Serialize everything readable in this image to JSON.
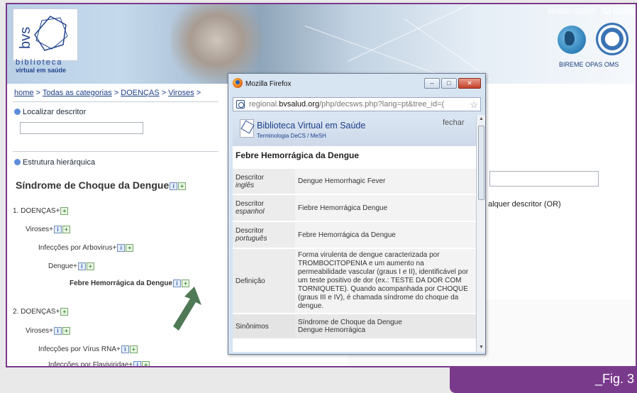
{
  "header": {
    "logo_text": "bvs",
    "logo_word": "biblioteca",
    "logo_sub": "virtual em saúde",
    "lang_es": "español",
    "lang_sep": "|",
    "lang_en": "english",
    "contact": "Contato",
    "orgs": "BIREME OPAS OMS"
  },
  "breadcrumb": {
    "home": "home",
    "cats": "Todas as categorias",
    "doencas": "DOENÇAS",
    "viroses": "Viroses",
    "sep": " > "
  },
  "search_section": {
    "title": "Localizar descritor"
  },
  "tree_section": {
    "title": "Estrutura hierárquica",
    "heading": "Síndrome de Choque da Dengue",
    "items": [
      {
        "label": "1. DOENÇAS+"
      },
      {
        "label": "Viroses+"
      },
      {
        "label": "Infecções por Arbovirus+"
      },
      {
        "label": "Dengue+"
      },
      {
        "label": "Febre Hemorrágica da Dengue"
      },
      {
        "label": "2. DOENÇAS+"
      },
      {
        "label": "Viroses+"
      },
      {
        "label": "Infecções por Vírus RNA+"
      },
      {
        "label": "Infecções por Flaviviridae+"
      }
    ]
  },
  "right_panel": {
    "option_text": "alquer descritor (OR)"
  },
  "popup": {
    "window_title": "Mozilla Firefox",
    "url_prefix": "regional.",
    "url_domain": "bvsalud.org",
    "url_rest": "/php/decsws.php?lang=pt&tree_id=(",
    "site_title": "Biblioteca Virtual em Saúde",
    "site_sub": "Terminologia DeCS / MeSH",
    "close_link": "fechar",
    "term": "Febre Hemorrágica da Dengue",
    "rows": [
      {
        "k1": "Descritor",
        "k2": "inglês",
        "v": "Dengue Hemorrhagic Fever"
      },
      {
        "k1": "Descritor",
        "k2": "espanhol",
        "v": "Fiebre Hemorrágica Dengue"
      },
      {
        "k1": "Descritor",
        "k2": "português",
        "v": "Febre Hemorrágica da Dengue"
      },
      {
        "k1": "Definição",
        "k2": "",
        "v": "Forma virulenta de dengue caracterizada por TROMBOCITOPENIA e um aumento na permeabilidade vascular (graus I e II), identificável por um teste positivo de dor (ex.: TESTE DA DOR COM TORNIQUETE). Quando acompanhada por CHOQUE (graus III e IV), é chamada síndrome do choque da dengue."
      },
      {
        "k1": "Sinônimos",
        "k2": "",
        "v1": "Síndrome de Choque da Dengue",
        "v2": "Dengue Hemorrágica"
      }
    ]
  },
  "figure_label": "_Fig. 3",
  "colors": {
    "frame": "#7a3a8c",
    "link": "#1d3e8a",
    "bullet": "#5b8dd9"
  }
}
